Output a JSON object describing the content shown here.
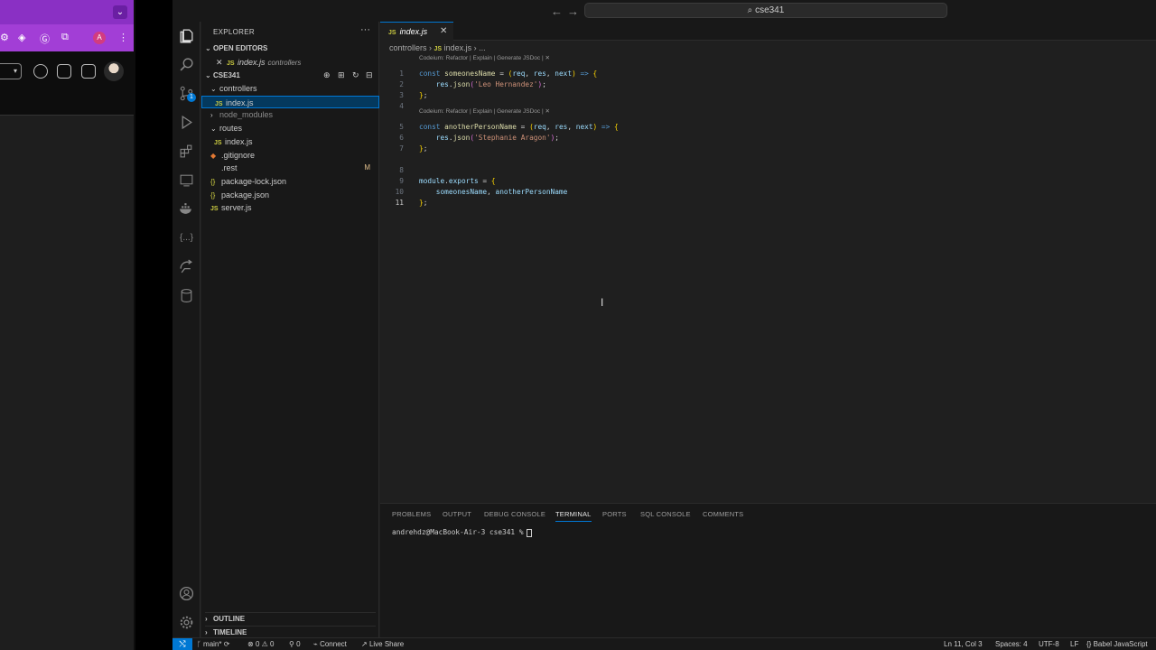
{
  "browser": {
    "dropdown_glyph": "⌄",
    "profile_letter": "A",
    "more_glyph": "⋮"
  },
  "titlebar": {
    "back": "←",
    "forward": "→",
    "search_text": "cse341"
  },
  "explorer": {
    "title": "EXPLORER",
    "more": "···",
    "open_editors_label": "OPEN EDITORS",
    "open_editor": {
      "name": "index.js",
      "folder": "controllers"
    },
    "project_label": "CSE341",
    "tree": [
      {
        "label": "controllers",
        "type": "folder-open"
      },
      {
        "label": "index.js",
        "type": "js",
        "selected": true
      },
      {
        "label": "node_modules",
        "type": "folder-closed",
        "dim": true
      },
      {
        "label": "routes",
        "type": "folder-open"
      },
      {
        "label": "index.js",
        "type": "js"
      },
      {
        "label": ".gitignore",
        "type": "git"
      },
      {
        "label": ".rest",
        "type": "file",
        "status": "M"
      },
      {
        "label": "package-lock.json",
        "type": "json"
      },
      {
        "label": "package.json",
        "type": "json"
      },
      {
        "label": "server.js",
        "type": "js"
      }
    ],
    "outline_label": "OUTLINE",
    "timeline_label": "TIMELINE"
  },
  "editor": {
    "tab_label": "index.js",
    "breadcrumb": [
      "controllers",
      "index.js",
      "..."
    ],
    "codelens": "Codeium: Refactor | Explain | Generate JSDoc | ✕",
    "lines": [
      {
        "n": "1",
        "tokens": [
          [
            "k",
            "const "
          ],
          [
            "f",
            "someonesName"
          ],
          [
            "p",
            " = "
          ],
          [
            "b1",
            "("
          ],
          [
            "v",
            "req"
          ],
          [
            "p",
            ", "
          ],
          [
            "v",
            "res"
          ],
          [
            "p",
            ", "
          ],
          [
            "v",
            "next"
          ],
          [
            "b1",
            ")"
          ],
          [
            "k",
            " => "
          ],
          [
            "b1",
            "{"
          ]
        ]
      },
      {
        "n": "2",
        "tokens": [
          [
            "p",
            "    "
          ],
          [
            "v",
            "res"
          ],
          [
            "p",
            "."
          ],
          [
            "f",
            "json"
          ],
          [
            "b2",
            "("
          ],
          [
            "s",
            "'Leo Hernandez'"
          ],
          [
            "b2",
            ")"
          ],
          [
            "p",
            ";"
          ]
        ]
      },
      {
        "n": "3",
        "tokens": [
          [
            "b1",
            "}"
          ],
          [
            "p",
            ";"
          ]
        ]
      },
      {
        "n": "4",
        "tokens": []
      },
      {
        "n": "5",
        "tokens": [
          [
            "k",
            "const "
          ],
          [
            "f",
            "anotherPersonName"
          ],
          [
            "p",
            " = "
          ],
          [
            "b1",
            "("
          ],
          [
            "v",
            "req"
          ],
          [
            "p",
            ", "
          ],
          [
            "v",
            "res"
          ],
          [
            "p",
            ", "
          ],
          [
            "v",
            "next"
          ],
          [
            "b1",
            ")"
          ],
          [
            "k",
            " => "
          ],
          [
            "b1",
            "{"
          ]
        ]
      },
      {
        "n": "6",
        "tokens": [
          [
            "p",
            "    "
          ],
          [
            "v",
            "res"
          ],
          [
            "p",
            "."
          ],
          [
            "f",
            "json"
          ],
          [
            "b2",
            "("
          ],
          [
            "s",
            "'Stephanie Aragon'"
          ],
          [
            "b2",
            ")"
          ],
          [
            "p",
            ";"
          ]
        ]
      },
      {
        "n": "7",
        "tokens": [
          [
            "b1",
            "}"
          ],
          [
            "p",
            ";"
          ]
        ]
      },
      {
        "n": "8",
        "tokens": []
      },
      {
        "n": "9",
        "tokens": [
          [
            "v",
            "module"
          ],
          [
            "p",
            "."
          ],
          [
            "v",
            "exports"
          ],
          [
            "p",
            " = "
          ],
          [
            "b1",
            "{"
          ]
        ]
      },
      {
        "n": "10",
        "tokens": [
          [
            "p",
            "    "
          ],
          [
            "v",
            "someonesName"
          ],
          [
            "p",
            ", "
          ],
          [
            "v",
            "anotherPersonName"
          ]
        ]
      },
      {
        "n": "11",
        "tokens": [
          [
            "b1",
            "}"
          ],
          [
            "p",
            ";"
          ]
        ]
      }
    ]
  },
  "panel": {
    "tabs": [
      "PROBLEMS",
      "OUTPUT",
      "DEBUG CONSOLE",
      "TERMINAL",
      "PORTS",
      "SQL CONSOLE",
      "COMMENTS"
    ],
    "active_tab": "TERMINAL",
    "terminal_prompt": "andrehdz@MacBook-Air-3 cse341 %"
  },
  "statusbar": {
    "branch": "main*",
    "errors": "0",
    "warnings": "0",
    "ports": "0",
    "connect": "Connect",
    "live_share": "Live Share",
    "cursor_position": "Ln 11, Col 3",
    "spaces": "Spaces: 4",
    "encoding": "UTF-8",
    "eol": "LF",
    "language": "Babel JavaScript"
  },
  "colors": {
    "accent": "#0078d4",
    "selection": "#04395e",
    "browser_purple": "#a23ed6"
  }
}
